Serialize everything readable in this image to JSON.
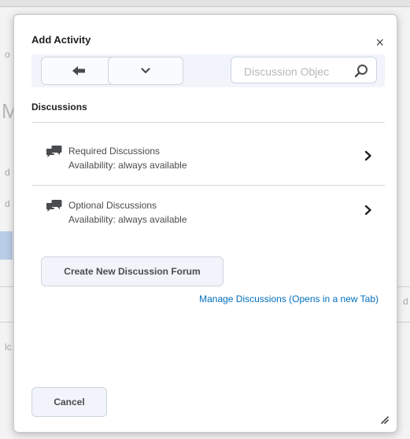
{
  "dialog": {
    "title": "Add Activity",
    "close_label": "×"
  },
  "toolbar": {
    "back_icon": "arrow-left-icon",
    "dropdown_icon": "chevron-down-icon",
    "search_placeholder": "Discussion Objec",
    "search_icon": "search-icon"
  },
  "section": {
    "title": "Discussions"
  },
  "items": [
    {
      "name": "Required Discussions",
      "availability": "Availability: always available",
      "icon": "discussion-bubbles-icon"
    },
    {
      "name": "Optional Discussions",
      "availability": "Availability: always available",
      "icon": "discussion-bubbles-icon"
    }
  ],
  "actions": {
    "create_label": "Create New Discussion Forum",
    "manage_label": "Manage Discussions (Opens in a new Tab)",
    "cancel_label": "Cancel"
  },
  "colors": {
    "link": "#006fbf",
    "toolbar_bg": "#f1f5fb",
    "divider": "#d3d9e3"
  }
}
